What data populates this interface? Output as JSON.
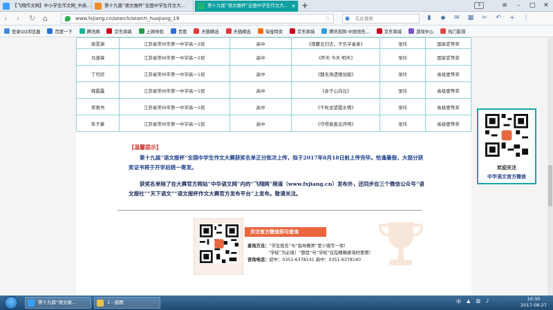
{
  "tabs": [
    {
      "label": "【飞翔作文网】中小学生作文网_中高...",
      "color": "#3aa0ff"
    },
    {
      "label": "第十九届“语文报杯”全国中学生作文大...",
      "color": "#f08a24"
    },
    {
      "label": "第十九届“语文报杯”全国中学生作文大...",
      "color": "#22b573"
    }
  ],
  "tab_count": "3",
  "address": {
    "url": "www.fxjiang.cn/search/search_huojiang_19",
    "search_placeholder": "在此搜索"
  },
  "bookmarks": [
    {
      "label": "登录QQ浏览器",
      "color": "#3a8fd8"
    },
    {
      "label": "百度一下",
      "color": "#2b6fd6"
    },
    {
      "label": "腾讯网",
      "color": "#1ab394"
    },
    {
      "label": "京东商城",
      "color": "#d0021b"
    },
    {
      "label": "上网导航",
      "color": "#2c9d4a"
    },
    {
      "label": "百度",
      "color": "#2b6fd6"
    },
    {
      "label": "天猫精选",
      "color": "#e4393c"
    },
    {
      "label": "天猫精选",
      "color": "#e4393c"
    },
    {
      "label": "淘宝特卖",
      "color": "#ff6a00"
    },
    {
      "label": "京东商城",
      "color": "#d0021b"
    },
    {
      "label": "腾讯视频-中国领先...",
      "color": "#2c9fd8"
    },
    {
      "label": "京东商城",
      "color": "#d0021b"
    },
    {
      "label": "游戏中心",
      "color": "#7b52c7"
    },
    {
      "label": "热门影视",
      "color": "#e04747"
    }
  ],
  "table": {
    "rows": [
      [
        "梁雯渊",
        "江苏省常州市第一中学高一2班",
        "高中",
        "《南麓北归去，不负学者身》",
        "张玲",
        "国家贰等奖"
      ],
      [
        "马逸锋",
        "江苏省常州市第一中学高一2班",
        "高中",
        "《昨天·今天·明天》",
        "张玲",
        "国家贰等奖"
      ],
      [
        "丁可欣",
        "江苏省常州市第一中学高一1班",
        "高中",
        "《魏无羡遗赠加赋》",
        "张玲",
        "省级壹等奖"
      ],
      [
        "韩霞露",
        "江苏省常州市第一中学高一1班",
        "高中",
        "《赤子心向北》",
        "张玲",
        "省级壹等奖"
      ],
      [
        "李雨书",
        "江苏省常州市第一中学高一1班",
        "高中",
        "《千秋龙望霞水情》",
        "张玲",
        "省级壹等奖"
      ],
      [
        "朱子豪",
        "江苏省常州市第一中学高一1班",
        "高中",
        "《守得真善见月明》",
        "张玲",
        "省级壹等奖"
      ]
    ]
  },
  "notice": {
    "title": "【温馨提示】",
    "para1": "第十九届“语文报杯”全国中学生作文大赛获奖名单正分批次上传，拟于2017年8月18日前上传完毕。恰逢暑假，大部分获奖证书将于开学后统一寄发。",
    "para2": "获奖名单除了在大赛官方网站“中华语文网”内的“飞翔网”频道（www.fxjiang.cn）发布外，还同步在三个微信公众号“语文报社”“天下语文”“语文报杯作文大赛官方发布平台”上发布。敬请关注。"
  },
  "wechat_box": {
    "banner": "关注官方微信即可查询",
    "method_label": "查询方法：",
    "method_line1": "“学生姓名”与“指导教师”至少填写一项！",
    "method_line2": "“学校”为必填！“题目”与“学校”仅在精确查询时使用！",
    "phone_label": "咨询电话：",
    "phone_line": "初中：0351-6378141       高中：0351-6378140"
  },
  "sidebar_qr": {
    "line1": "欢迎关注",
    "line2": "中华语文官方微信"
  },
  "taskbar": {
    "items": [
      {
        "label": "第十九届“语文报...",
        "color": "#3aa0ff"
      },
      {
        "label": "1 - 画图",
        "color": "#e8c34a"
      }
    ],
    "time": "10:30",
    "date": "2017-08-27"
  }
}
